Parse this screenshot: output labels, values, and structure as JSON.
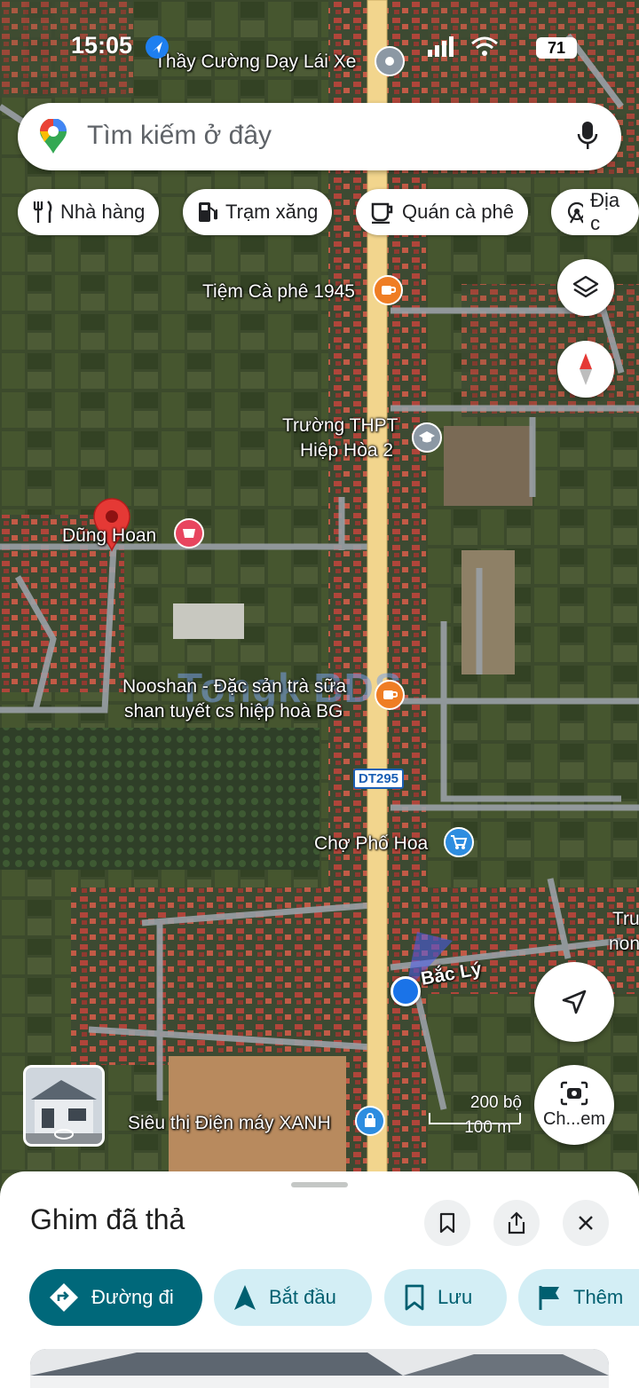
{
  "status_bar": {
    "time": "15:05",
    "battery": "71"
  },
  "search": {
    "placeholder": "Tìm kiếm ở đây"
  },
  "chips": [
    "Nhà hàng",
    "Trạm xăng",
    "Quán cà phê",
    "Địa c"
  ],
  "map": {
    "labels": {
      "thay_cuong": "Thầy Cường Dạy Lái Xe",
      "cafe_1945": "Tiệm Cà phê 1945",
      "truong_line1": "Trường THPT",
      "truong_line2": "Hiệp Hòa 2",
      "dung_hoan": "Dũng Hoan",
      "nooshan_line1": "Nooshan - Đặc sản trà sữa",
      "nooshan_line2": "shan tuyết cs hiệp hoà BG",
      "road": "DT295",
      "cho_pho_hoa": "Chợ Phố Hoa",
      "bac_ly": "Bắc Lý",
      "sieu_thi": "Siêu thị Điện máy XANH",
      "edge_line1": "Tru",
      "edge_line2": "non",
      "watermark": "Tongk BDS"
    },
    "scale": {
      "feet": "200 bộ",
      "meters": "100 m"
    },
    "camera_label": "Ch...em"
  },
  "sheet": {
    "title": "Ghim đã thả",
    "actions": [
      "Đường đi",
      "Bắt đầu",
      "Lưu",
      "Thêm"
    ]
  }
}
